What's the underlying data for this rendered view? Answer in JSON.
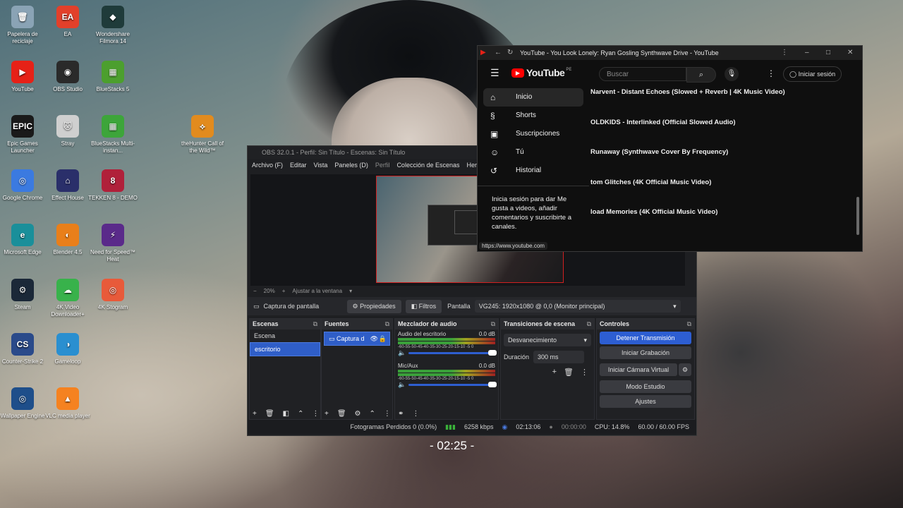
{
  "desktop": {
    "icons": [
      {
        "label": "Papelera de reciclaje",
        "color": "#8aa3b5",
        "glyph": "🗑"
      },
      {
        "label": "EA",
        "color": "#e2402a",
        "glyph": "EA"
      },
      {
        "label": "Wondershare Filmora 14",
        "color": "#1f3b3a",
        "glyph": "◆"
      },
      {
        "label": "YouTube",
        "color": "#e62117",
        "glyph": "▶"
      },
      {
        "label": "OBS Studio",
        "color": "#2a2a2a",
        "glyph": "◉"
      },
      {
        "label": "BlueStacks 5",
        "color": "#4c9f2e",
        "glyph": "▦"
      },
      {
        "label": "Epic Games Launcher",
        "color": "#1a1a1a",
        "glyph": "EPIC"
      },
      {
        "label": "Stray",
        "color": "#cfcfcf",
        "glyph": "🐱"
      },
      {
        "label": "BlueStacks Multi-instan...",
        "color": "#3da53a",
        "glyph": "▦"
      },
      {
        "label": "theHunter Call of the Wild™",
        "color": "#e28b1e",
        "glyph": "⟡"
      },
      {
        "label": "Google Chrome",
        "color": "#3b7ae0",
        "glyph": "◎"
      },
      {
        "label": "Effect House",
        "color": "#2a2f6a",
        "glyph": "⌂"
      },
      {
        "label": "TEKKEN 8 - DEMO",
        "color": "#b0203a",
        "glyph": "8"
      },
      {
        "label": "Microsoft Edge",
        "color": "#1a8f9a",
        "glyph": "e"
      },
      {
        "label": "Blender 4.5",
        "color": "#e97f1a",
        "glyph": "◐"
      },
      {
        "label": "Need for Speed™ Heat",
        "color": "#5a2a8a",
        "glyph": "⚡"
      },
      {
        "label": "Steam",
        "color": "#1b2838",
        "glyph": "⚙"
      },
      {
        "label": "4K Video Downloader+",
        "color": "#38b24b",
        "glyph": "☁"
      },
      {
        "label": "4K Stogram",
        "color": "#e85a3a",
        "glyph": "◎"
      },
      {
        "label": "Counter-Strike 2",
        "color": "#2a4a8a",
        "glyph": "CS"
      },
      {
        "label": "Gameloop",
        "color": "#2a8fd0",
        "glyph": "◑"
      },
      {
        "label": "Wallpaper Engine",
        "color": "#1e4e8a",
        "glyph": "◎"
      },
      {
        "label": "VLC media player",
        "color": "#f58220",
        "glyph": "▲"
      }
    ],
    "timer": "- 02:25 -"
  },
  "obs": {
    "title": "OBS 32.0.1 - Perfil: Sin Título - Escenas: Sin Título",
    "menu": [
      "Archivo (F)",
      "Editar",
      "Vista",
      "Paneles (D)",
      "Perfil",
      "Colección de Escenas",
      "Herram"
    ],
    "zoom": {
      "minus": "−",
      "value": "20%",
      "plus": "+",
      "fit": "Ajustar a la ventana"
    },
    "source_bar": {
      "source_name": "Captura de pantalla",
      "properties": "Propiedades",
      "filters": "Filtros",
      "display_label": "Pantalla",
      "display_value": "VG245: 1920x1080 @ 0,0 (Monitor principal)"
    },
    "docks": {
      "scenes": {
        "title": "Escenas",
        "items": [
          "Escena",
          "escritorio"
        ],
        "selected": 1
      },
      "sources": {
        "title": "Fuentes",
        "items": [
          "Captura d"
        ]
      },
      "mixer": {
        "title": "Mezclador de audio",
        "channels": [
          {
            "name": "Audio del escritorio",
            "db": "0.0 dB"
          },
          {
            "name": "Mic/Aux",
            "db": "0.0 dB"
          }
        ],
        "scale": "-60-55-50-45-40-35-30-25-20-15-10 -5 0"
      },
      "transitions": {
        "title": "Transiciones de escena",
        "type": "Desvanecimiento",
        "duration_label": "Duración",
        "duration_value": "300 ms"
      },
      "controls": {
        "title": "Controles",
        "buttons": [
          "Detener Transmisión",
          "Iniciar Grabación",
          "Iniciar Cámara Virtual",
          "Modo Estudio",
          "Ajustes"
        ]
      }
    },
    "status": {
      "dropped": "Fotogramas Perdidos 0 (0.0%)",
      "bitrate": "6258 kbps",
      "stream_time": "02:13:06",
      "rec_time": "00:00:00",
      "cpu": "CPU: 14.8%",
      "fps": "60.00 / 60.00 FPS"
    }
  },
  "youtube": {
    "window_title": "YouTube - You Look Lonely: Ryan Gosling Synthwave Drive - YouTube",
    "logo": "YouTube",
    "region": "PE",
    "search_placeholder": "Buscar",
    "signin": "Iniciar sesión",
    "guide": [
      {
        "label": "Inicio",
        "icon": "home-icon"
      },
      {
        "label": "Shorts",
        "icon": "shorts-icon"
      },
      {
        "label": "Suscripciones",
        "icon": "subscriptions-icon"
      },
      {
        "label": "Tú",
        "icon": "you-icon"
      },
      {
        "label": "Historial",
        "icon": "history-icon"
      }
    ],
    "signin_message": "Inicia sesión para dar Me gusta a videos, añadir comentarios y suscribirte a canales.",
    "status_url": "https://www.youtube.com",
    "videos": [
      "Narvent - Distant Echoes (Slowed + Reverb | 4K Music Video)",
      "OLDKIDS - Interlinked (Official Slowed Audio)",
      "Runaway (Synthwave Cover By Frequency)",
      "tom Glitches (4K Official Music Video)",
      "load Memories (4K Official Music Video)"
    ]
  }
}
